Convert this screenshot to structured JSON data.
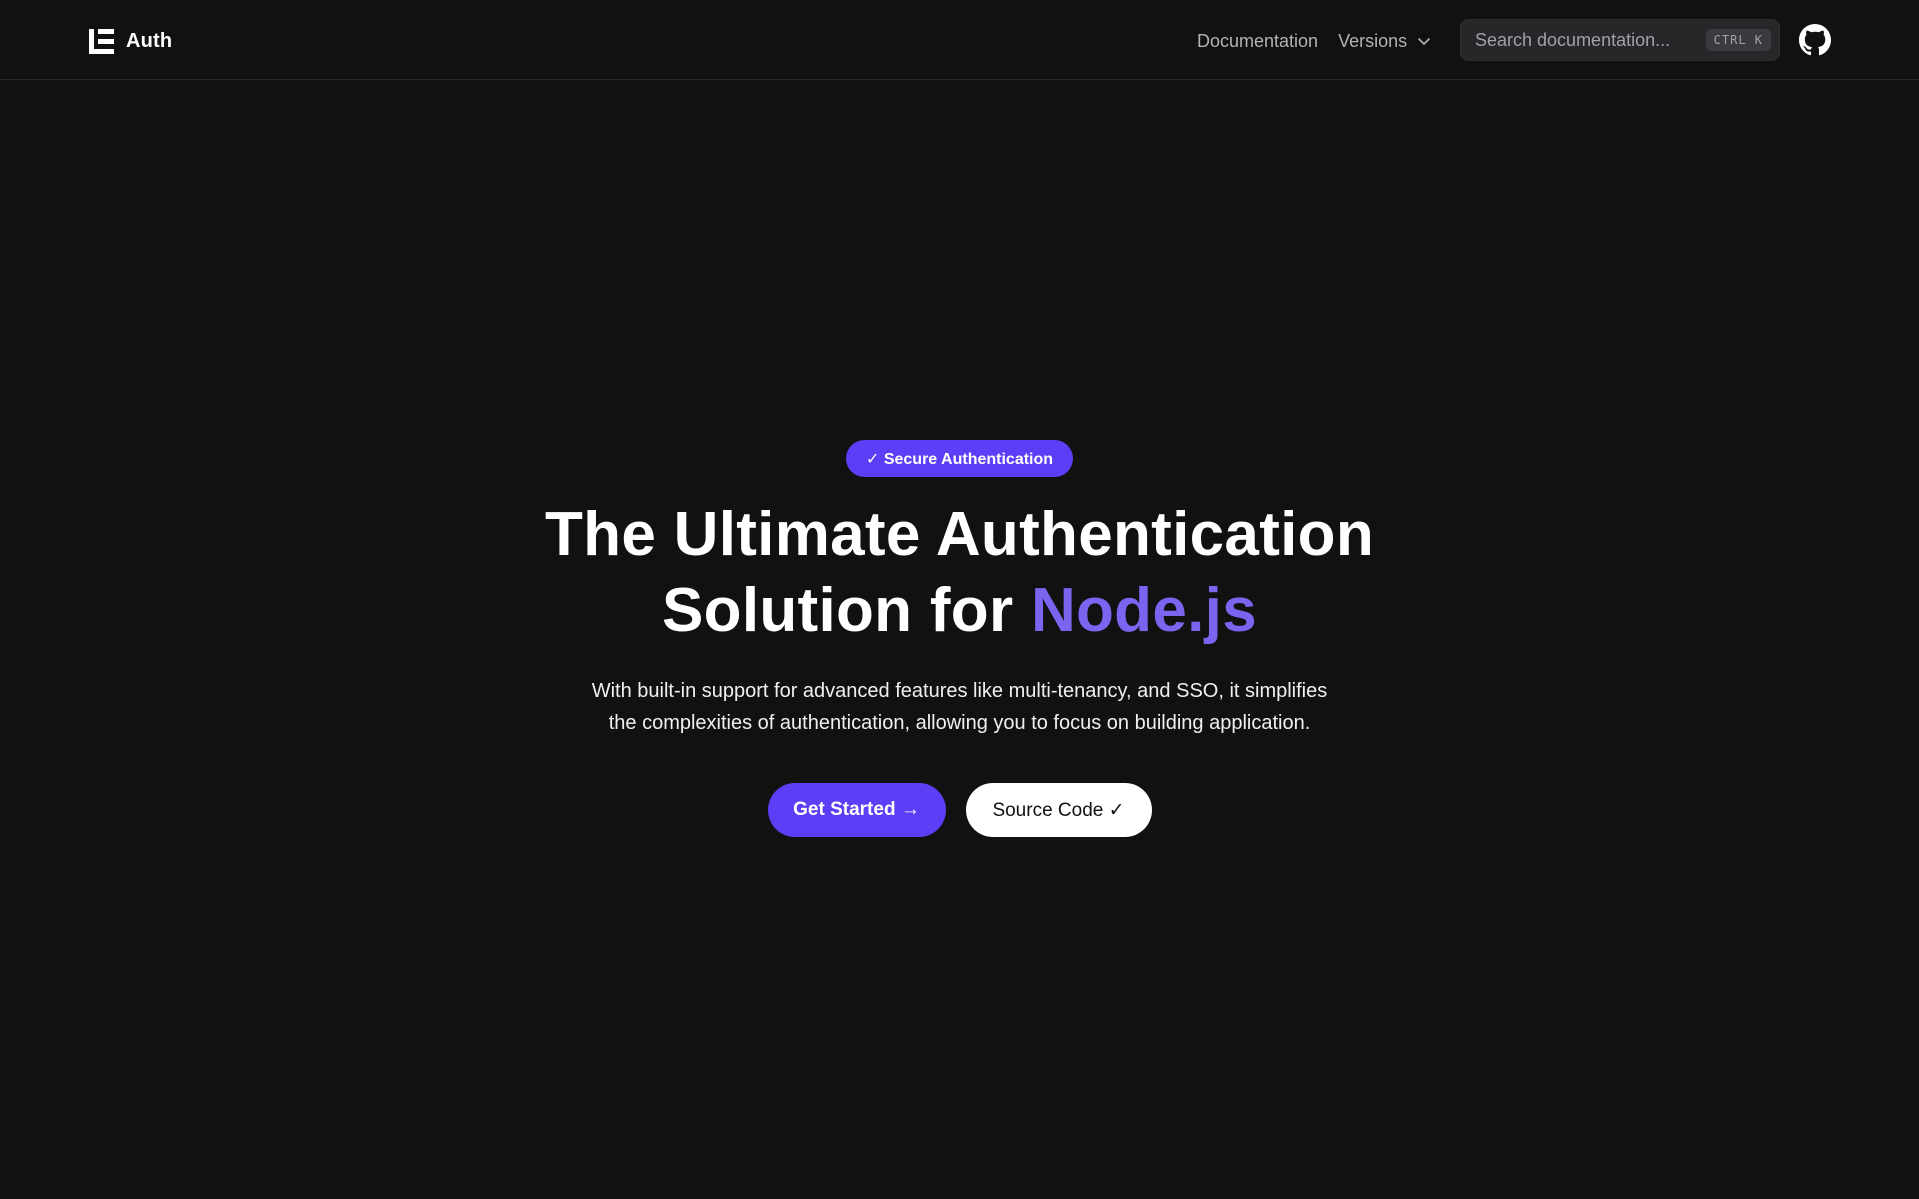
{
  "colors": {
    "background": "#111111",
    "accent": "#5b3ef5",
    "accent_text": "#7c63f0",
    "muted_text": "#b3b3b3"
  },
  "navbar": {
    "brand": {
      "name": "Auth",
      "logo_icon": "auth-logo-icon"
    },
    "links": [
      {
        "label": "Documentation"
      },
      {
        "label": "Versions",
        "icon": "chevron-down-icon"
      }
    ],
    "search": {
      "placeholder": "Search documentation...",
      "shortcut": "CTRL K"
    },
    "github_icon": "github-icon"
  },
  "hero": {
    "badge": "✓ Secure Authentication",
    "headline_line1": "The Ultimate Authentication",
    "headline_line2_prefix": "Solution for ",
    "headline_line2_accent": "Node.js",
    "subtitle": "With built-in support for advanced features like multi-tenancy, and SSO, it simplifies the complexities of authentication, allowing you to focus on building application.",
    "primary_button": "Get Started →",
    "secondary_button": "Source Code ✓"
  }
}
